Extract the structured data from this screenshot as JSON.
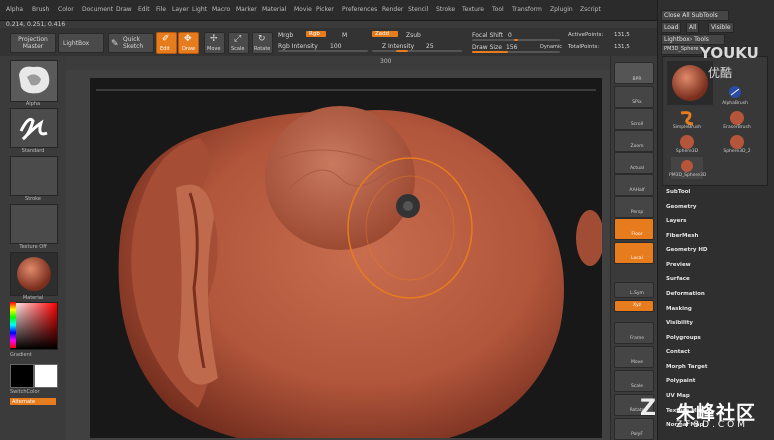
{
  "menu": [
    "Alpha",
    "Brush",
    "Color",
    "Document",
    "Draw",
    "Edit",
    "File",
    "Layer",
    "Light",
    "Macro",
    "Marker",
    "Material",
    "Movie",
    "Picker",
    "Preferences",
    "Render",
    "Stencil",
    "Stroke",
    "Texture",
    "Tool",
    "Transform",
    "Zplugin",
    "Zscript"
  ],
  "coords": "0.214, 0.251, 0.416",
  "toolbar": {
    "projection_master": "Projection Master",
    "lightbox": "LightBox",
    "quick_sketch": "Quick Sketch",
    "edit": "Edit",
    "draw": "Draw",
    "move": "Move",
    "scale": "Scale",
    "rotate": "Rotate",
    "mrgb": "Mrgb",
    "rgb": "Rgb",
    "m": "M",
    "zadd": "Zadd",
    "zsub": "Zsub",
    "rgb_intensity_label": "Rgb Intensity",
    "rgb_intensity": "100",
    "z_intensity_label": "Z Intensity",
    "z_intensity": "25",
    "focal_shift_label": "Focal Shift",
    "focal_shift": "0",
    "draw_size_label": "Draw Size",
    "draw_size": "156",
    "dynamic": "Dynamic",
    "active_points_label": "ActivePoints:",
    "active_points": "131,5",
    "total_points_label": "TotalPoints:",
    "total_points": "131,5"
  },
  "ruler_value": "300",
  "left_shelf": {
    "labels": [
      "Alpha",
      "Standard",
      "Stroke",
      "Texture Off",
      "Material",
      "Gradient",
      "SwitchColor",
      "Alternate"
    ]
  },
  "right_shelf": {
    "labels": [
      "BPR",
      "SPix",
      "Scroll",
      "Zoom",
      "Actual",
      "AAHalf",
      "Persp",
      "Floor",
      "Local",
      "L.Sym",
      "Xyz",
      "Frame",
      "Move",
      "Scale",
      "Rotate",
      "PolyF"
    ]
  },
  "tray": {
    "close_all": "Close All SubTools",
    "load": "Load",
    "all": "All",
    "visible": "Visible",
    "lightbox_tools": "Lightbox› Tools",
    "tool_name": "PM3D_Sphere",
    "brushes": [
      "AlphaBrush",
      "SimpleBrush",
      "EraserBrush",
      "Sphere3D",
      "Sphere3D_2",
      "PM3D_Sphere3D"
    ],
    "subtools": [
      "SubTool",
      "Geometry",
      "Layers",
      "FiberMesh",
      "Geometry HD",
      "Preview",
      "Surface",
      "Deformation",
      "Masking",
      "Visibility",
      "Polygroups",
      "Contact",
      "Morph Target",
      "Polypaint",
      "UV Map",
      "Texture Map",
      "Normal Map"
    ]
  },
  "watermark": {
    "youku": "YOUKU",
    "youku_cn": "优酷",
    "zf3d": "朱峰社区",
    "zf3d_url": "ZF3D.COM",
    "logo_z": "Z"
  },
  "colors": {
    "accent": "#e67c1e",
    "clay": "#b55a3e"
  }
}
